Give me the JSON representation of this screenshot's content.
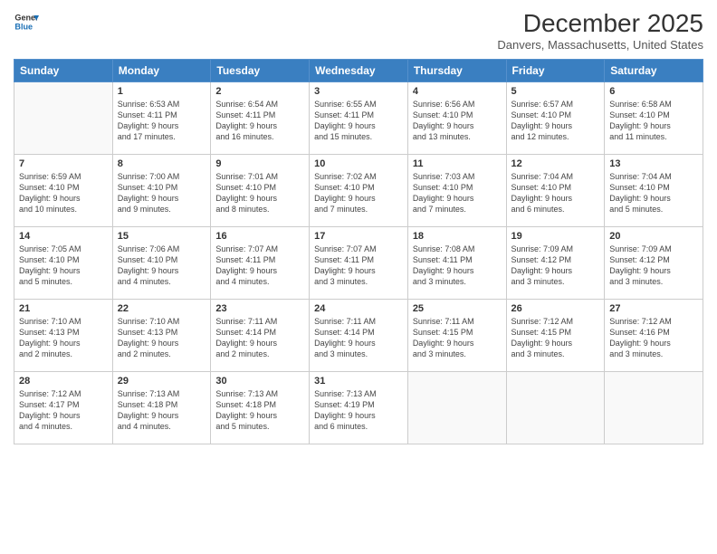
{
  "header": {
    "logo_line1": "General",
    "logo_line2": "Blue",
    "month_title": "December 2025",
    "location": "Danvers, Massachusetts, United States"
  },
  "weekdays": [
    "Sunday",
    "Monday",
    "Tuesday",
    "Wednesday",
    "Thursday",
    "Friday",
    "Saturday"
  ],
  "weeks": [
    [
      {
        "day": "",
        "info": ""
      },
      {
        "day": "1",
        "info": "Sunrise: 6:53 AM\nSunset: 4:11 PM\nDaylight: 9 hours\nand 17 minutes."
      },
      {
        "day": "2",
        "info": "Sunrise: 6:54 AM\nSunset: 4:11 PM\nDaylight: 9 hours\nand 16 minutes."
      },
      {
        "day": "3",
        "info": "Sunrise: 6:55 AM\nSunset: 4:11 PM\nDaylight: 9 hours\nand 15 minutes."
      },
      {
        "day": "4",
        "info": "Sunrise: 6:56 AM\nSunset: 4:10 PM\nDaylight: 9 hours\nand 13 minutes."
      },
      {
        "day": "5",
        "info": "Sunrise: 6:57 AM\nSunset: 4:10 PM\nDaylight: 9 hours\nand 12 minutes."
      },
      {
        "day": "6",
        "info": "Sunrise: 6:58 AM\nSunset: 4:10 PM\nDaylight: 9 hours\nand 11 minutes."
      }
    ],
    [
      {
        "day": "7",
        "info": "Sunrise: 6:59 AM\nSunset: 4:10 PM\nDaylight: 9 hours\nand 10 minutes."
      },
      {
        "day": "8",
        "info": "Sunrise: 7:00 AM\nSunset: 4:10 PM\nDaylight: 9 hours\nand 9 minutes."
      },
      {
        "day": "9",
        "info": "Sunrise: 7:01 AM\nSunset: 4:10 PM\nDaylight: 9 hours\nand 8 minutes."
      },
      {
        "day": "10",
        "info": "Sunrise: 7:02 AM\nSunset: 4:10 PM\nDaylight: 9 hours\nand 7 minutes."
      },
      {
        "day": "11",
        "info": "Sunrise: 7:03 AM\nSunset: 4:10 PM\nDaylight: 9 hours\nand 7 minutes."
      },
      {
        "day": "12",
        "info": "Sunrise: 7:04 AM\nSunset: 4:10 PM\nDaylight: 9 hours\nand 6 minutes."
      },
      {
        "day": "13",
        "info": "Sunrise: 7:04 AM\nSunset: 4:10 PM\nDaylight: 9 hours\nand 5 minutes."
      }
    ],
    [
      {
        "day": "14",
        "info": "Sunrise: 7:05 AM\nSunset: 4:10 PM\nDaylight: 9 hours\nand 5 minutes."
      },
      {
        "day": "15",
        "info": "Sunrise: 7:06 AM\nSunset: 4:10 PM\nDaylight: 9 hours\nand 4 minutes."
      },
      {
        "day": "16",
        "info": "Sunrise: 7:07 AM\nSunset: 4:11 PM\nDaylight: 9 hours\nand 4 minutes."
      },
      {
        "day": "17",
        "info": "Sunrise: 7:07 AM\nSunset: 4:11 PM\nDaylight: 9 hours\nand 3 minutes."
      },
      {
        "day": "18",
        "info": "Sunrise: 7:08 AM\nSunset: 4:11 PM\nDaylight: 9 hours\nand 3 minutes."
      },
      {
        "day": "19",
        "info": "Sunrise: 7:09 AM\nSunset: 4:12 PM\nDaylight: 9 hours\nand 3 minutes."
      },
      {
        "day": "20",
        "info": "Sunrise: 7:09 AM\nSunset: 4:12 PM\nDaylight: 9 hours\nand 3 minutes."
      }
    ],
    [
      {
        "day": "21",
        "info": "Sunrise: 7:10 AM\nSunset: 4:13 PM\nDaylight: 9 hours\nand 2 minutes."
      },
      {
        "day": "22",
        "info": "Sunrise: 7:10 AM\nSunset: 4:13 PM\nDaylight: 9 hours\nand 2 minutes."
      },
      {
        "day": "23",
        "info": "Sunrise: 7:11 AM\nSunset: 4:14 PM\nDaylight: 9 hours\nand 2 minutes."
      },
      {
        "day": "24",
        "info": "Sunrise: 7:11 AM\nSunset: 4:14 PM\nDaylight: 9 hours\nand 3 minutes."
      },
      {
        "day": "25",
        "info": "Sunrise: 7:11 AM\nSunset: 4:15 PM\nDaylight: 9 hours\nand 3 minutes."
      },
      {
        "day": "26",
        "info": "Sunrise: 7:12 AM\nSunset: 4:15 PM\nDaylight: 9 hours\nand 3 minutes."
      },
      {
        "day": "27",
        "info": "Sunrise: 7:12 AM\nSunset: 4:16 PM\nDaylight: 9 hours\nand 3 minutes."
      }
    ],
    [
      {
        "day": "28",
        "info": "Sunrise: 7:12 AM\nSunset: 4:17 PM\nDaylight: 9 hours\nand 4 minutes."
      },
      {
        "day": "29",
        "info": "Sunrise: 7:13 AM\nSunset: 4:18 PM\nDaylight: 9 hours\nand 4 minutes."
      },
      {
        "day": "30",
        "info": "Sunrise: 7:13 AM\nSunset: 4:18 PM\nDaylight: 9 hours\nand 5 minutes."
      },
      {
        "day": "31",
        "info": "Sunrise: 7:13 AM\nSunset: 4:19 PM\nDaylight: 9 hours\nand 6 minutes."
      },
      {
        "day": "",
        "info": ""
      },
      {
        "day": "",
        "info": ""
      },
      {
        "day": "",
        "info": ""
      }
    ]
  ]
}
